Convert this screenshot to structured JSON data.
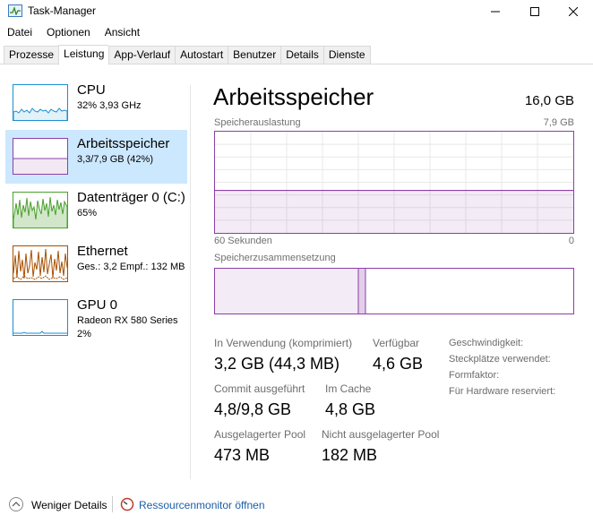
{
  "window": {
    "title": "Task-Manager"
  },
  "menu": [
    "Datei",
    "Optionen",
    "Ansicht"
  ],
  "tabs": [
    "Prozesse",
    "Leistung",
    "App-Verlauf",
    "Autostart",
    "Benutzer",
    "Details",
    "Dienste"
  ],
  "active_tab": "Leistung",
  "sidebar": {
    "items": [
      {
        "title": "CPU",
        "sub": "32%  3,93 GHz",
        "sub2": "",
        "color": "#1a8fd1"
      },
      {
        "title": "Arbeitsspeicher",
        "sub": "3,3/7,9 GB (42%)",
        "sub2": "",
        "color": "#8b3fa8"
      },
      {
        "title": "Datenträger 0 (C:)",
        "sub": "65%",
        "sub2": "",
        "color": "#4aa02c"
      },
      {
        "title": "Ethernet",
        "sub": "Ges.: 3,2  Empf.: 132 MB",
        "sub2": "",
        "color": "#a74f01"
      },
      {
        "title": "GPU 0",
        "sub": "Radeon RX 580 Series",
        "sub2": "2%",
        "color": "#1a8fd1"
      }
    ]
  },
  "main": {
    "title": "Arbeitsspeicher",
    "total": "16,0 GB",
    "graph_label": "Speicherauslastung",
    "graph_max": "7,9 GB",
    "time_left": "60 Sekunden",
    "time_right": "0",
    "composition_label": "Speicherzusammensetzung",
    "usage_fraction": 0.42,
    "composition_in_use_fraction": 0.4,
    "composition_modified_fraction": 0.02
  },
  "stats": {
    "in_use_label": "In Verwendung (komprimiert)",
    "in_use_value": "3,2 GB (44,3 MB)",
    "available_label": "Verfügbar",
    "available_value": "4,6 GB",
    "commit_label": "Commit ausgeführt",
    "commit_value": "4,8/9,8 GB",
    "cache_label": "Im Cache",
    "cache_value": "4,8 GB",
    "paged_label": "Ausgelagerter Pool",
    "paged_value": "473 MB",
    "nonpaged_label": "Nicht ausgelagerter Pool",
    "nonpaged_value": "182 MB"
  },
  "info": [
    "Geschwindigkeit:",
    "Steckplätze verwendet:",
    "Formfaktor:",
    "Für Hardware reserviert:"
  ],
  "footer": {
    "fewer_details": "Weniger Details",
    "resource_monitor": "Ressourcenmonitor öffnen"
  }
}
